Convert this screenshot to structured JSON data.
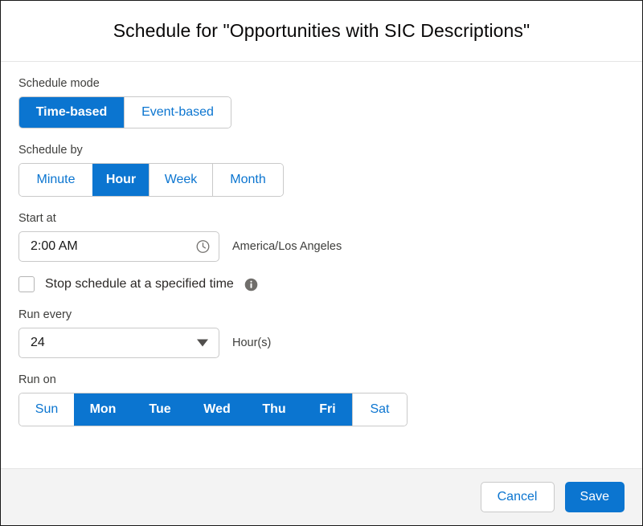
{
  "dialog": {
    "title": "Schedule for \"Opportunities with SIC Descriptions\""
  },
  "schedule_mode": {
    "label": "Schedule mode",
    "options": [
      {
        "label": "Time-based",
        "selected": true
      },
      {
        "label": "Event-based",
        "selected": false
      }
    ]
  },
  "schedule_by": {
    "label": "Schedule by",
    "options": [
      {
        "label": "Minute",
        "selected": false
      },
      {
        "label": "Hour",
        "selected": true
      },
      {
        "label": "Week",
        "selected": false
      },
      {
        "label": "Month",
        "selected": false
      }
    ]
  },
  "start_at": {
    "label": "Start at",
    "value": "2:00 AM",
    "placeholder": "2:00 AM",
    "icon": "clock-icon",
    "timezone": "America/Los Angeles"
  },
  "stop_schedule": {
    "label": "Stop schedule at a specified time",
    "checked": false,
    "info_icon": "info-icon"
  },
  "run_every": {
    "label": "Run every",
    "value": "24",
    "unit": "Hour(s)",
    "caret_icon": "chevron-down-icon"
  },
  "run_on": {
    "label": "Run on",
    "days": [
      {
        "label": "Sun",
        "selected": false
      },
      {
        "label": "Mon",
        "selected": true
      },
      {
        "label": "Tue",
        "selected": true
      },
      {
        "label": "Wed",
        "selected": true
      },
      {
        "label": "Thu",
        "selected": true
      },
      {
        "label": "Fri",
        "selected": true
      },
      {
        "label": "Sat",
        "selected": false
      }
    ]
  },
  "footer": {
    "cancel_label": "Cancel",
    "save_label": "Save"
  },
  "colors": {
    "brand_blue": "#0b75d0",
    "link_blue": "#0b75d0",
    "text_dark": "#181818",
    "label_gray": "#3e3e3c",
    "border_gray": "#c9c9c9",
    "footer_bg": "#f3f3f3"
  }
}
